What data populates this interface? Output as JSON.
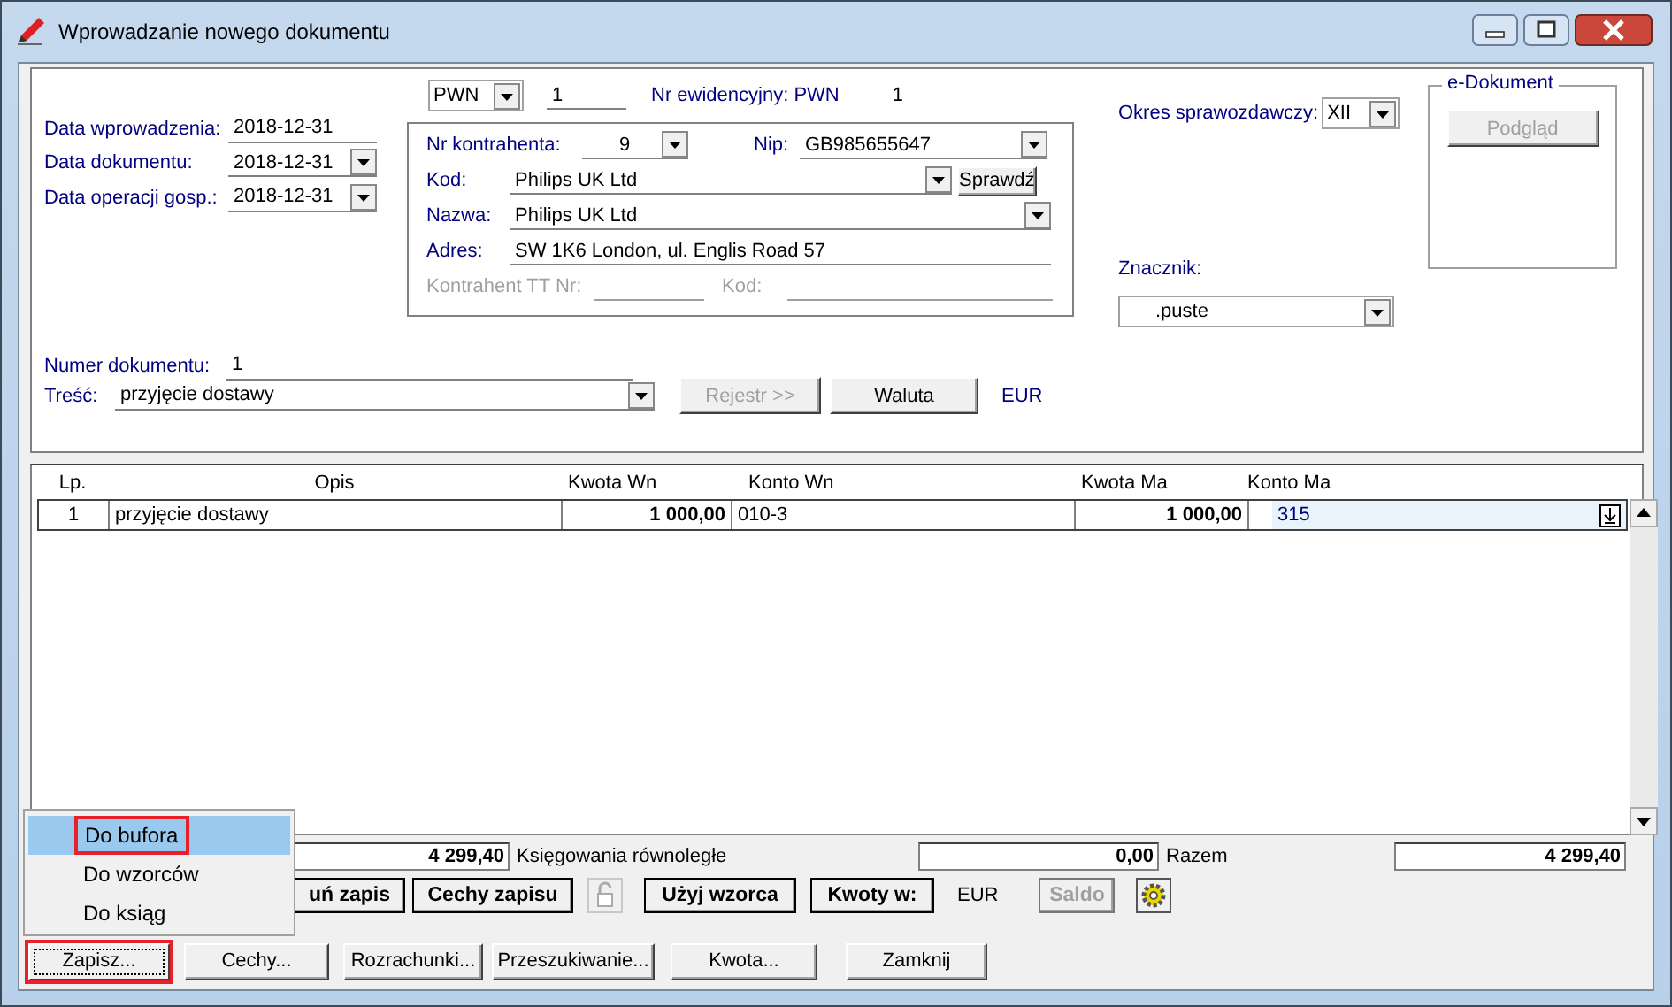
{
  "window": {
    "title": "Wprowadzanie nowego dokumentu"
  },
  "dates": [
    {
      "label": "Data wprowadzenia:",
      "value": "2018-12-31",
      "kind": "text"
    },
    {
      "label": "Data dokumentu:",
      "value": "2018-12-31",
      "kind": "combo"
    },
    {
      "label": "Data operacji gosp.:",
      "value": "2018-12-31",
      "kind": "combo"
    }
  ],
  "document_type": "PWN",
  "series_number": "1",
  "register": {
    "label": "Nr ewidencyjny: PWN",
    "value": "1"
  },
  "contractor": {
    "number": {
      "label": "Nr kontrahenta:",
      "value": "9"
    },
    "nip": {
      "label": "Nip:",
      "value": "GB985655647"
    },
    "code": {
      "label": "Kod:",
      "value": "Philips UK Ltd"
    },
    "check_button": "Sprawdź",
    "name": {
      "label": "Nazwa:",
      "value": "Philips UK Ltd"
    },
    "address": {
      "label": "Adres:",
      "value": "SW 1K6 London, ul. Englis Road 57"
    },
    "tt_number": {
      "label": "Kontrahent TT Nr:",
      "disabled": true
    },
    "tt_code": {
      "label": "Kod:",
      "disabled": true
    }
  },
  "period": {
    "label": "Okres sprawozdawczy:",
    "value": "XII"
  },
  "e_document": {
    "title": "e-Dokument",
    "button": {
      "label": "Podgląd",
      "disabled": true
    }
  },
  "marker": {
    "label": "Znacznik:",
    "value": ".puste"
  },
  "document_number": {
    "label": "Numer dokumentu:",
    "value": "1"
  },
  "content": {
    "label": "Treść:",
    "value": "przyjęcie dostawy"
  },
  "register_button": {
    "label": "Rejestr >>",
    "disabled": true
  },
  "currency_button": {
    "label": "Waluta",
    "disabled": false
  },
  "currency": "EUR",
  "table": {
    "columns": [
      "Lp.",
      "Opis",
      "Kwota Wn",
      "Konto Wn",
      "Kwota Ma",
      "Konto Ma"
    ],
    "rows": [
      {
        "cells": [
          "1",
          "przyjęcie dostawy",
          "1 000,00",
          "010-3",
          "1 000,00",
          "315"
        ],
        "selected": true
      }
    ]
  },
  "totals": [
    {
      "value": "4 299,40",
      "label": "Księgowania równoległe"
    },
    {
      "value": "0,00",
      "label": "Razem"
    },
    {
      "value": "4 299,40"
    }
  ],
  "entry_buttons": [
    {
      "kind": "button",
      "label": "uń zapis",
      "disabled": false
    },
    {
      "kind": "button",
      "label": "Cechy zapisu",
      "disabled": false
    },
    {
      "kind": "lock"
    },
    {
      "kind": "button",
      "label": "Użyj wzorca",
      "disabled": false
    },
    {
      "kind": "button",
      "label": "Kwoty w:",
      "disabled": false
    },
    {
      "kind": "text",
      "label": "EUR"
    },
    {
      "kind": "button",
      "label": "Saldo",
      "disabled": true
    },
    {
      "kind": "gear"
    }
  ],
  "buttons": [
    {
      "label": "Zapisz...",
      "highlighted": true
    },
    {
      "label": "Cechy...",
      "highlighted": false
    },
    {
      "label": "Rozrachunki...",
      "highlighted": false
    },
    {
      "label": "Przeszukiwanie...",
      "highlighted": false
    },
    {
      "label": "Kwota...",
      "highlighted": false
    },
    {
      "label": "Zamknij",
      "highlighted": false
    }
  ],
  "menu": [
    {
      "label": "Do bufora",
      "selected": true,
      "highlighted": true
    },
    {
      "label": "Do wzorców",
      "selected": false,
      "highlighted": false
    },
    {
      "label": "Do ksiąg",
      "selected": false,
      "highlighted": false
    }
  ]
}
